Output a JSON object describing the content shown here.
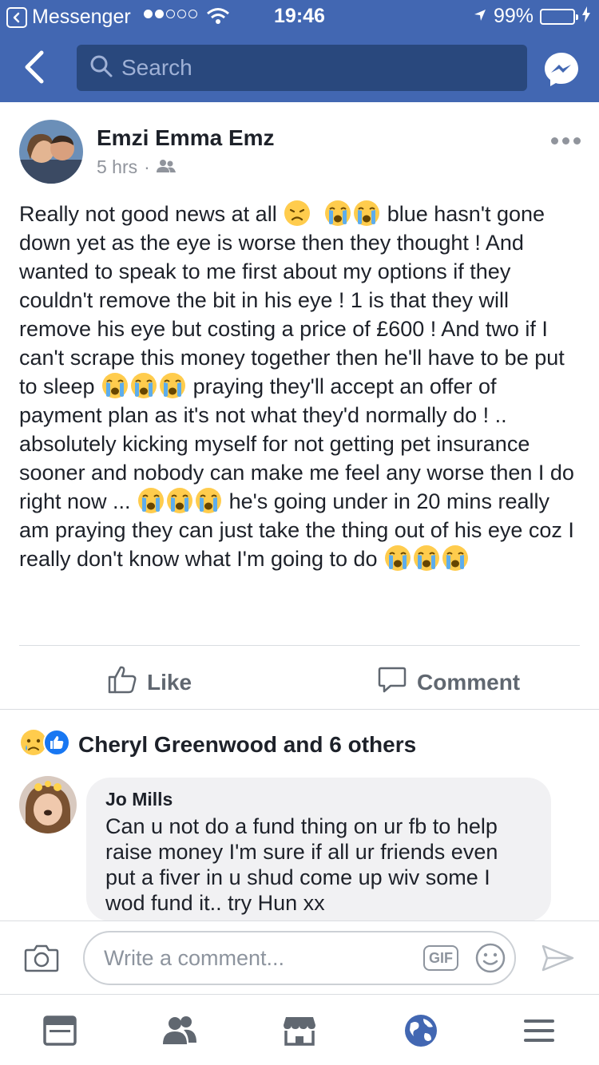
{
  "status_bar": {
    "back_app": "Messenger",
    "time": "19:46",
    "battery": "99%"
  },
  "nav": {
    "search_placeholder": "Search"
  },
  "post": {
    "author": "Emzi Emma Emz",
    "time": "5 hrs",
    "text_parts": [
      "Really not good news at all ",
      " blue hasn't gone down yet as the eye is worse then they thought ! And wanted to speak to me first about my options if they couldn't remove the bit in his eye ! 1 is that they will remove his eye but costing a price of £600 ! And two if I can't scrape this money together then he'll have to be put to sleep ",
      " praying they'll accept an offer of payment plan as it's not what they'd normally do ! .. absolutely kicking myself for not getting pet insurance sooner and nobody can make me feel any worse then I do right now ... ",
      " he's going under in 20 mins really am praying they can just take the thing out of his eye coz I really don't know what I'm going to do "
    ]
  },
  "actions": {
    "like": "Like",
    "comment": "Comment"
  },
  "reactions": {
    "text": "Cheryl Greenwood and 6 others"
  },
  "comment": {
    "name": "Jo Mills",
    "text": "Can u not do a fund thing on ur fb to help raise money I'm sure if all ur friends even put a fiver in u shud come up wiv some I wod fund it.. try Hun xx"
  },
  "composer": {
    "placeholder": "Write a comment...",
    "gif_label": "GIF"
  },
  "colors": {
    "brand": "#4267b2",
    "search_bg": "#29487d",
    "active_tab": "#4267b2",
    "inactive": "#606770"
  }
}
